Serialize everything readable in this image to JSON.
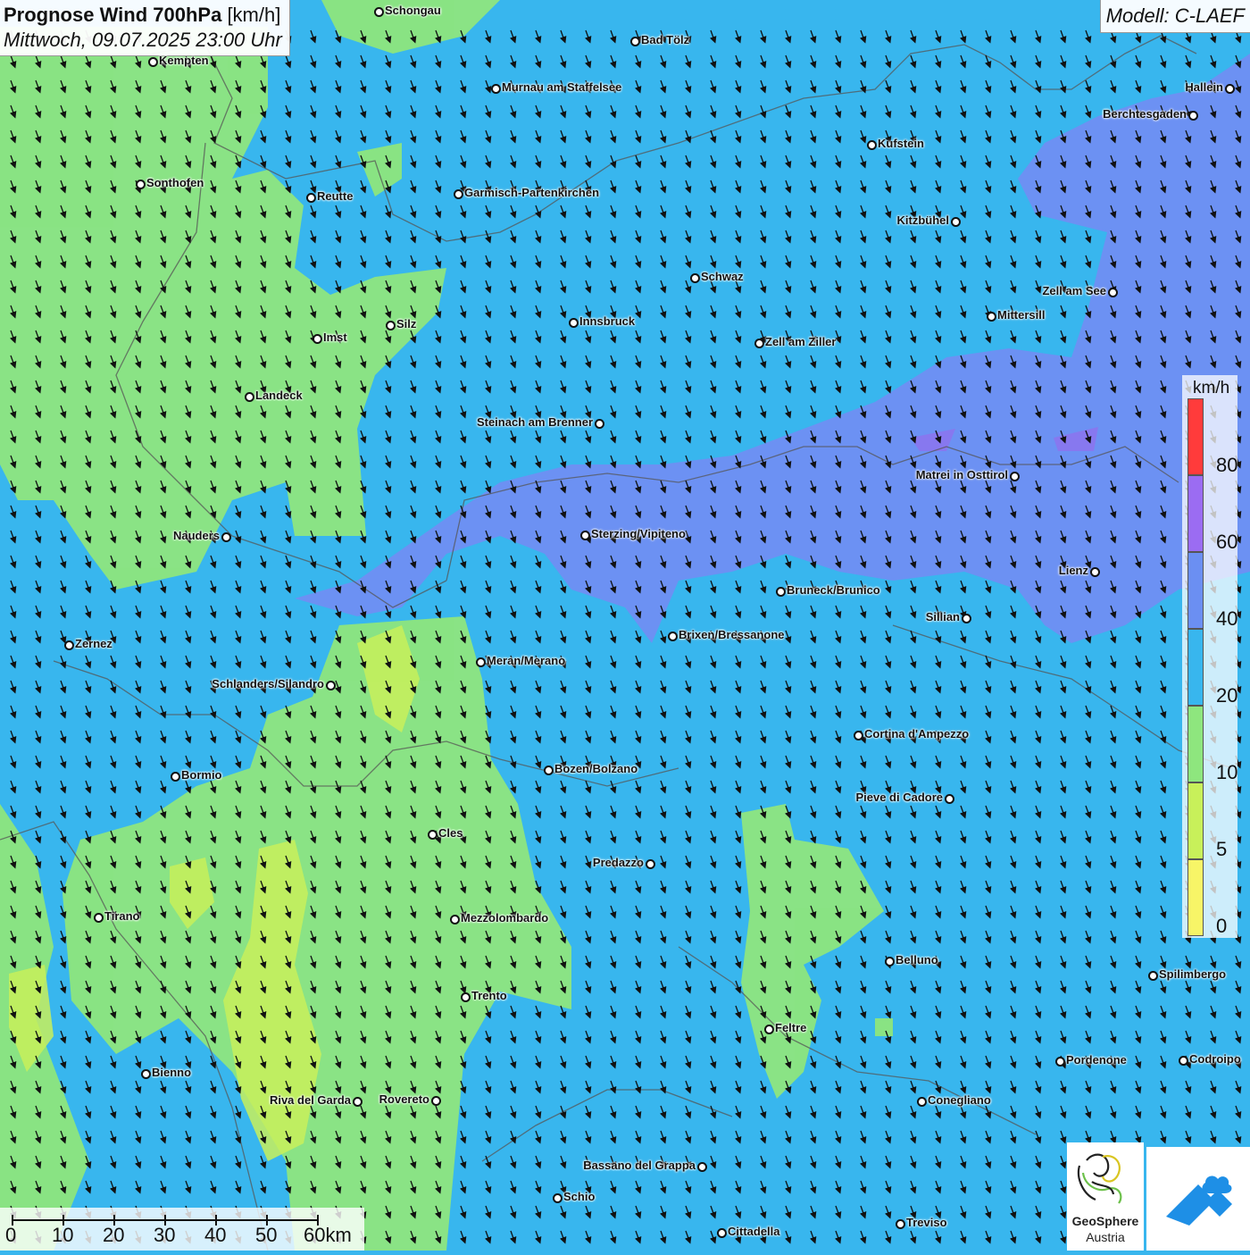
{
  "header": {
    "title_bold": "Prognose Wind 700hPa",
    "title_unit": "[km/h]",
    "datetime": "Mittwoch, 09.07.2025 23:00 Uhr",
    "model": "Modell: C-LAEF"
  },
  "legend": {
    "unit": "km/h",
    "ticks": [
      "0",
      "5",
      "10",
      "20",
      "40",
      "60",
      "80"
    ],
    "colors": [
      "#f7f567",
      "#c8f05a",
      "#8ee67e",
      "#38b6ee",
      "#6b8ff2",
      "#9b6cf2",
      "#ff3b3b"
    ]
  },
  "scalebar": {
    "labels": [
      "0",
      "10",
      "20",
      "30",
      "40",
      "50",
      "60km"
    ]
  },
  "logo": {
    "name": "GeoSphere",
    "sub": "Austria"
  },
  "cities": [
    {
      "name": "Schongau"
    },
    {
      "name": "Bad Tölz"
    },
    {
      "name": "Kempten"
    },
    {
      "name": "Murnau am Staffelsee"
    },
    {
      "name": "Hallein"
    },
    {
      "name": "Berchtesgaden"
    },
    {
      "name": "Kufstein"
    },
    {
      "name": "Sonthofen"
    },
    {
      "name": "Reutte"
    },
    {
      "name": "Garmisch-Partenkirchen"
    },
    {
      "name": "Kitzbühel"
    },
    {
      "name": "Schwaz"
    },
    {
      "name": "Zell am See"
    },
    {
      "name": "Mittersill"
    },
    {
      "name": "Innsbruck"
    },
    {
      "name": "Silz"
    },
    {
      "name": "Imst"
    },
    {
      "name": "Zell am Ziller"
    },
    {
      "name": "Landeck"
    },
    {
      "name": "Steinach am Brenner"
    },
    {
      "name": "Matrei in Osttirol"
    },
    {
      "name": "Nauders"
    },
    {
      "name": "Sterzing/Vipiteno"
    },
    {
      "name": "Lienz"
    },
    {
      "name": "Bruneck/Brunico"
    },
    {
      "name": "Sillian"
    },
    {
      "name": "Brixen/Bressanone"
    },
    {
      "name": "Zernez"
    },
    {
      "name": "Meran/Merano"
    },
    {
      "name": "Schlanders/Silandro"
    },
    {
      "name": "Cortina d'Ampezzo"
    },
    {
      "name": "Bozen/Bolzano"
    },
    {
      "name": "Bormio"
    },
    {
      "name": "Pieve di Cadore"
    },
    {
      "name": "Cles"
    },
    {
      "name": "Predazzo"
    },
    {
      "name": "Tirano"
    },
    {
      "name": "Mezzolombardo"
    },
    {
      "name": "Belluno"
    },
    {
      "name": "Spilimbergo"
    },
    {
      "name": "Trento"
    },
    {
      "name": "Feltre"
    },
    {
      "name": "Pordenone"
    },
    {
      "name": "Codroipo"
    },
    {
      "name": "Bienno"
    },
    {
      "name": "Riva del Garda"
    },
    {
      "name": "Rovereto"
    },
    {
      "name": "Conegliano"
    },
    {
      "name": "Bassano del Grappa"
    },
    {
      "name": "Schio"
    },
    {
      "name": "Treviso"
    },
    {
      "name": "Cittadella"
    }
  ]
}
